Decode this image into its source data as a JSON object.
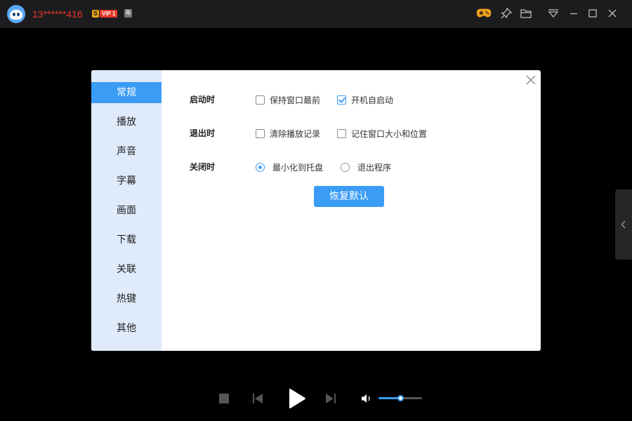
{
  "titlebar": {
    "username": "13******416",
    "s_badge": "S",
    "vip_badge": "VIP 1",
    "year_badge": "年",
    "icons": [
      "game-controller-icon",
      "pin-icon",
      "folder-icon",
      "menu-dropdown-icon",
      "minimize-icon",
      "maximize-icon",
      "close-icon"
    ]
  },
  "dialog": {
    "sidebar": {
      "items": [
        {
          "label": "常规",
          "active": true
        },
        {
          "label": "播放"
        },
        {
          "label": "声音"
        },
        {
          "label": "字幕"
        },
        {
          "label": "画面"
        },
        {
          "label": "下载"
        },
        {
          "label": "关联"
        },
        {
          "label": "热键"
        },
        {
          "label": "其他"
        }
      ]
    },
    "startup": {
      "label": "启动时",
      "keep_on_top": {
        "label": "保持窗口最前",
        "checked": false
      },
      "auto_start": {
        "label": "开机自启动",
        "checked": true
      }
    },
    "exit": {
      "label": "退出时",
      "clear_history": {
        "label": "清除播放记录",
        "checked": false
      },
      "remember_window": {
        "label": "记住窗口大小和位置",
        "checked": false
      }
    },
    "close": {
      "label": "关闭时",
      "minimize_tray": {
        "label": "最小化到托盘",
        "selected": true
      },
      "exit_program": {
        "label": "退出程序",
        "selected": false
      }
    },
    "restore_defaults": "恢复默认"
  },
  "player": {
    "volume": 0.5
  },
  "colors": {
    "accent": "#3b9cf6",
    "username": "#e8372a",
    "sidebar_bg": "#dfeafb",
    "titlebar_bg": "#1c1c1e"
  }
}
